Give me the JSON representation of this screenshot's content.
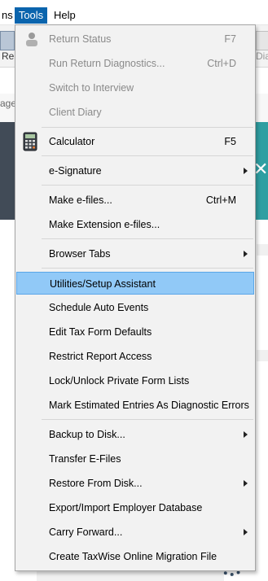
{
  "menubar": {
    "left_fragment": "ns",
    "tools": "Tools",
    "help": "Help"
  },
  "background": {
    "re_fragment": "Re",
    "dia_fragment": "Dia",
    "page_fragment": "age"
  },
  "menu": {
    "items": [
      {
        "label": "Return Status",
        "shortcut": "F7",
        "disabled": true,
        "icon": "user-status-icon"
      },
      {
        "label": "Run Return Diagnostics...",
        "shortcut": "Ctrl+D",
        "disabled": true
      },
      {
        "label": "Switch to Interview",
        "disabled": true
      },
      {
        "label": "Client Diary",
        "disabled": true
      },
      {
        "label": "Calculator",
        "shortcut": "F5",
        "icon": "calculator-icon"
      },
      {
        "label": "e-Signature",
        "submenu": true
      },
      {
        "label": "Make e-files...",
        "shortcut": "Ctrl+M"
      },
      {
        "label": "Make Extension e-files..."
      },
      {
        "label": "Browser Tabs",
        "submenu": true
      },
      {
        "label": "Utilities/Setup Assistant",
        "highlighted": true
      },
      {
        "label": "Schedule Auto Events"
      },
      {
        "label": "Edit Tax Form Defaults"
      },
      {
        "label": "Restrict Report Access"
      },
      {
        "label": "Lock/Unlock Private Form Lists"
      },
      {
        "label": "Mark Estimated Entries As Diagnostic Errors"
      },
      {
        "label": "Backup to Disk...",
        "submenu": true
      },
      {
        "label": "Transfer E-Files"
      },
      {
        "label": "Restore From Disk...",
        "submenu": true
      },
      {
        "label": "Export/Import Employer Database"
      },
      {
        "label": "Carry Forward...",
        "submenu": true
      },
      {
        "label": "Create TaxWise Online Migration File"
      }
    ]
  },
  "colors": {
    "menu_bg": "#f2f2f2",
    "highlight": "#91c9f7",
    "tools_active": "#0a64ad",
    "disabled_text": "#8a8a8a"
  }
}
